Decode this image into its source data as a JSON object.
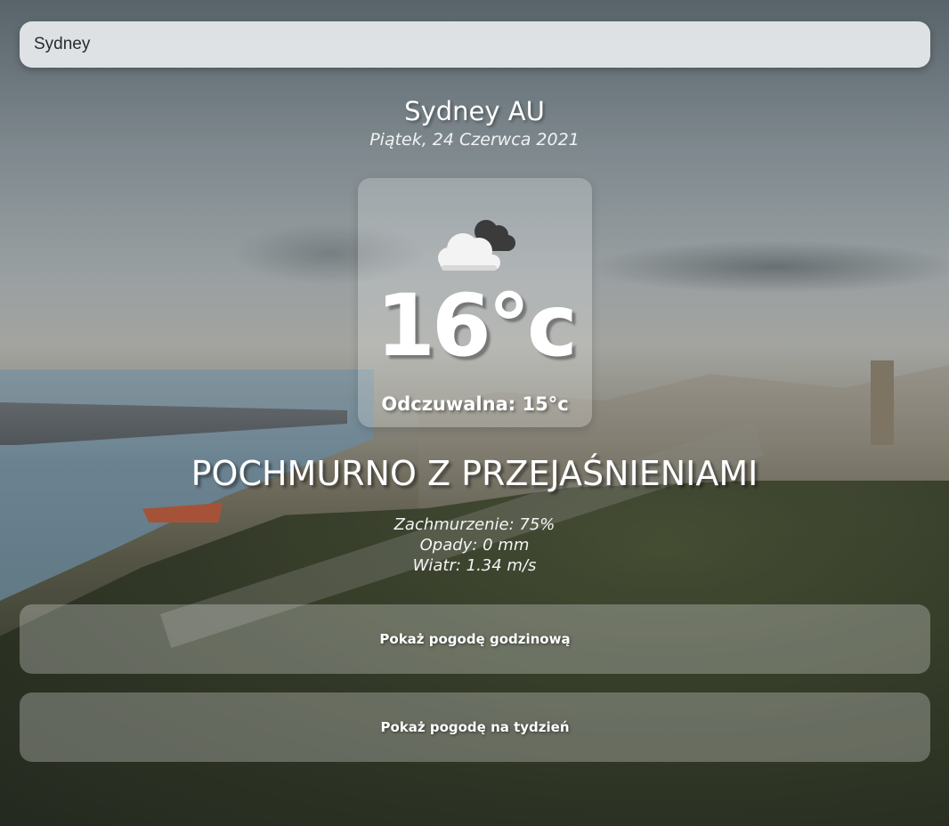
{
  "search": {
    "value": "Sydney"
  },
  "location": {
    "city_country": "Sydney AU",
    "date": "Piątek, 24 Czerwca 2021"
  },
  "current": {
    "temperature": "16°c",
    "feels_like": "Odczuwalna: 15°c",
    "condition": "POCHMURNO Z PRZEJAŚNIENIAMI",
    "icon": "partly-cloudy-icon"
  },
  "details": {
    "clouds": "Zachmurzenie: 75%",
    "precipitation": "Opady: 0 mm",
    "wind": "Wiatr: 1.34 m/s"
  },
  "buttons": {
    "hourly": "Pokaż pogodę godzinową",
    "weekly": "Pokaż pogodę na tydzień"
  }
}
